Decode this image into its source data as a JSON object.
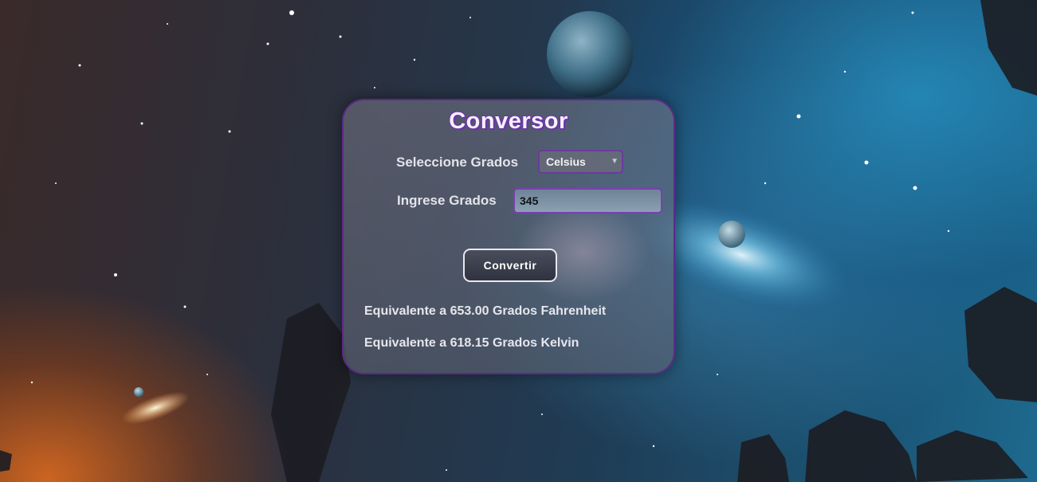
{
  "converter": {
    "title": "Conversor",
    "select_label": "Seleccione Grados",
    "selected_unit": "Celsius",
    "input_label": "Ingrese Grados",
    "input_value": "345",
    "convert_button": "Convertir",
    "result_fahrenheit": "Equivalente a 653.00 Grados Fahrenheit",
    "result_kelvin": "Equivalente a 618.15 Grados Kelvin"
  },
  "icons": {
    "select_arrow": "chevron-down-icon"
  },
  "colors": {
    "card_border": "#5b2a86",
    "title_outline": "#6a35a8",
    "input_border": "#7a3fb0"
  }
}
